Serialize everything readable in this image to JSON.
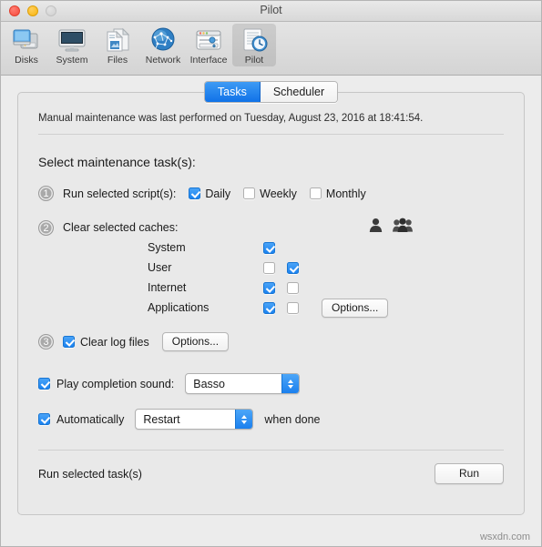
{
  "window": {
    "title": "Pilot",
    "traffic_lights": [
      "close",
      "minimize",
      "zoom"
    ]
  },
  "toolbar": {
    "items": [
      {
        "label": "Disks",
        "icon": "disks-icon",
        "active": false
      },
      {
        "label": "System",
        "icon": "system-icon",
        "active": false
      },
      {
        "label": "Files",
        "icon": "files-icon",
        "active": false
      },
      {
        "label": "Network",
        "icon": "network-icon",
        "active": false
      },
      {
        "label": "Interface",
        "icon": "interface-icon",
        "active": false
      },
      {
        "label": "Pilot",
        "icon": "pilot-icon",
        "active": true
      }
    ]
  },
  "tabs": {
    "items": [
      {
        "label": "Tasks",
        "selected": true
      },
      {
        "label": "Scheduler",
        "selected": false
      }
    ]
  },
  "main": {
    "notice": "Manual maintenance was last performed on Tuesday, August 23, 2016 at 18:41:54.",
    "section_title": "Select maintenance task(s):",
    "step1": {
      "number": "1",
      "label": "Run selected script(s):",
      "options": [
        {
          "label": "Daily",
          "checked": true
        },
        {
          "label": "Weekly",
          "checked": false
        },
        {
          "label": "Monthly",
          "checked": false
        }
      ]
    },
    "step2": {
      "number": "2",
      "label": "Clear selected caches:",
      "column_icons": [
        "single-user-icon",
        "all-users-icon"
      ],
      "rows": [
        {
          "name": "System",
          "user_checked": true,
          "user_present": true,
          "all_checked": false,
          "all_present": false,
          "options_button": null
        },
        {
          "name": "User",
          "user_checked": false,
          "user_present": true,
          "all_checked": true,
          "all_present": true,
          "options_button": null
        },
        {
          "name": "Internet",
          "user_checked": true,
          "user_present": true,
          "all_checked": false,
          "all_present": true,
          "options_button": null
        },
        {
          "name": "Applications",
          "user_checked": true,
          "user_present": true,
          "all_checked": false,
          "all_present": true,
          "options_button": "Options..."
        }
      ]
    },
    "step3": {
      "number": "3",
      "label": "Clear log files",
      "checked": true,
      "options_button": "Options..."
    },
    "sound": {
      "label": "Play completion sound:",
      "checked": true,
      "value": "Basso"
    },
    "automatic": {
      "label": "Automatically",
      "checked": true,
      "value": "Restart",
      "suffix": "when done"
    },
    "run": {
      "label": "Run selected task(s)",
      "button": "Run"
    }
  },
  "watermark": "wsxdn.com",
  "colors": {
    "accent": "#1b82f0",
    "window_bg": "#ececec",
    "panel_bg": "#e9e9e9"
  }
}
